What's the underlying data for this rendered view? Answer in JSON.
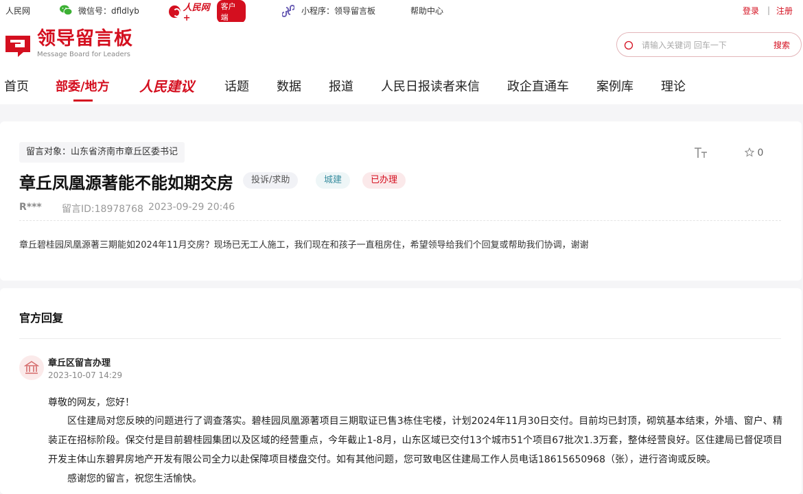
{
  "topbar": {
    "site": "人民网",
    "wechat": "微信号：dfldlyb",
    "brand_script": "人民网+",
    "client_badge": "客户端",
    "mini_program": "小程序：领导留言板",
    "help": "帮助中心",
    "login": "登录",
    "separator": "|",
    "register": "注册"
  },
  "header": {
    "logo_title": "领导留言板",
    "logo_sub": "Message Board for Leaders",
    "search_placeholder": "请输入关键词 回车一下",
    "search_button": "搜索"
  },
  "nav": {
    "items": [
      "首页",
      "部委/地方",
      "人民建议",
      "话题",
      "数据",
      "报道",
      "人民日报读者来信",
      "政企直通车",
      "案例库",
      "理论"
    ],
    "active_index": 1
  },
  "message": {
    "target": "留言对象：山东省济南市章丘区委书记",
    "title": "章丘凤凰源著能不能如期交房",
    "tag_type": "投诉/求助",
    "tag_category": "城建",
    "tag_status": "已办理",
    "user": "R***",
    "id_label": "留言ID:18978768",
    "time": "2023-09-29 20:46",
    "favorite_count": "0",
    "body": "章丘碧桂园凤凰源著三期能如2024年11月交房？现场已无工人施工，我们现在和孩子一直租房住，希望领导给我们个回复或帮助我们协调，谢谢"
  },
  "reply": {
    "heading": "官方回复",
    "org": "章丘区留言办理",
    "time": "2023-10-07 14:29",
    "greeting": "尊敬的网友，您好！",
    "paragraph": "区住建局对您反映的问题进行了调查落实。碧桂园凤凰源著项目三期取证已售3栋住宅楼，计划2024年11月30日交付。目前均已封顶，砌筑基本结束，外墙、窗户、精装正在招标阶段。保交付是目前碧桂园集团以及区域的经营重点，今年截止1-8月，山东区域已交付13个城市51个项目67批次1.3万套，整体经营良好。区住建局已督促项目开发主体山东碧昇房地产开发有限公司全力以赴保障项目楼盘交付。如有其他问题，您可致电区住建局工作人员电话18615650968（张），进行咨询或反映。",
    "thanks": "感谢您的留言，祝您生活愉快。"
  },
  "colors": {
    "accent": "#d40f1f",
    "background": "#f5f5f7"
  }
}
